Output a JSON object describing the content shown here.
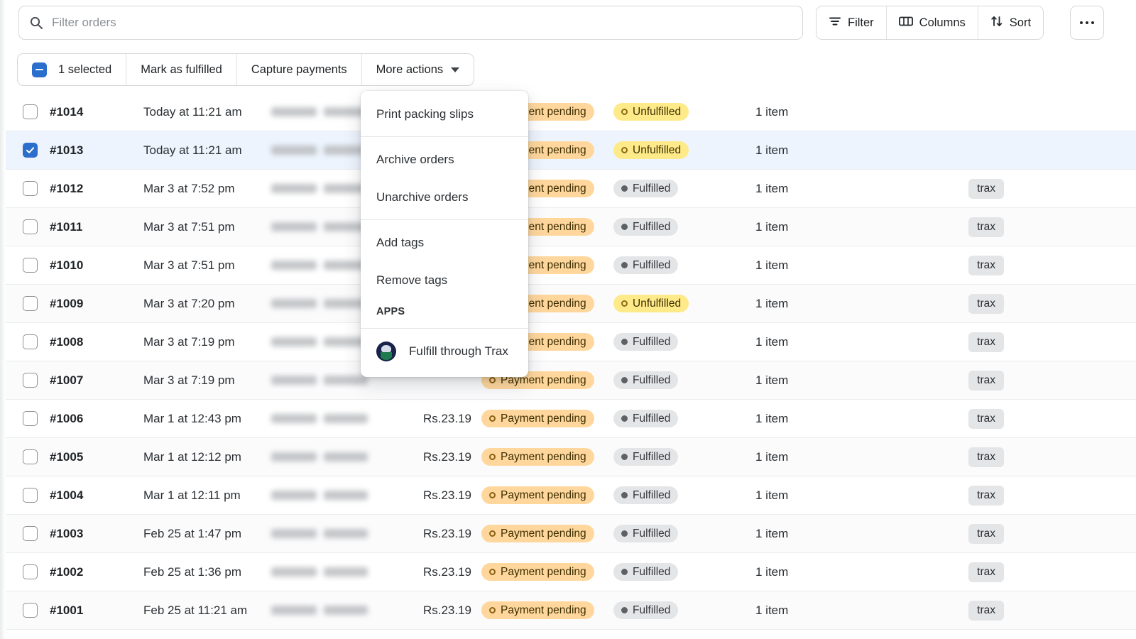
{
  "search": {
    "placeholder": "Filter orders",
    "value": "",
    "icon": "search-icon"
  },
  "toolbar": {
    "filter_label": "Filter",
    "columns_label": "Columns",
    "sort_label": "Sort",
    "more_label": "•••"
  },
  "bulk_bar": {
    "selected_label": "1 selected",
    "mark_fulfilled_label": "Mark as fulfilled",
    "capture_payments_label": "Capture payments",
    "more_actions_label": "More actions"
  },
  "menu": {
    "groups": [
      {
        "items": [
          {
            "label": "Print packing slips"
          }
        ]
      },
      {
        "items": [
          {
            "label": "Archive orders"
          },
          {
            "label": "Unarchive orders"
          }
        ]
      },
      {
        "items": [
          {
            "label": "Add tags"
          },
          {
            "label": "Remove tags"
          }
        ]
      }
    ],
    "section_label": "APPS",
    "app_item": {
      "label": "Fulfill through Trax",
      "icon": "trax-app-icon"
    }
  },
  "colors": {
    "accent": "#2c6ecb",
    "selected_row": "#edf4fd",
    "payment_pending_bg": "#ffd79d",
    "unfulfilled_bg": "#ffea8a",
    "fulfilled_bg": "#e4e5e7",
    "tag_bg": "#e4e5e7"
  },
  "table": {
    "rows": [
      {
        "order": "#1014",
        "date": "Today at 11:21 am",
        "customer": "",
        "total": "",
        "payment": "Payment pending",
        "fulfillment": "Unfulfilled",
        "items": "1 item",
        "tag": "",
        "selected": false
      },
      {
        "order": "#1013",
        "date": "Today at 11:21 am",
        "customer": "",
        "total": "",
        "payment": "Payment pending",
        "fulfillment": "Unfulfilled",
        "items": "1 item",
        "tag": "",
        "selected": true
      },
      {
        "order": "#1012",
        "date": "Mar 3 at 7:52 pm",
        "customer": "",
        "total": "",
        "payment": "Payment pending",
        "fulfillment": "Fulfilled",
        "items": "1 item",
        "tag": "trax",
        "selected": false
      },
      {
        "order": "#1011",
        "date": "Mar 3 at 7:51 pm",
        "customer": "",
        "total": "",
        "payment": "Payment pending",
        "fulfillment": "Fulfilled",
        "items": "1 item",
        "tag": "trax",
        "selected": false
      },
      {
        "order": "#1010",
        "date": "Mar 3 at 7:51 pm",
        "customer": "",
        "total": "",
        "payment": "Payment pending",
        "fulfillment": "Fulfilled",
        "items": "1 item",
        "tag": "trax",
        "selected": false
      },
      {
        "order": "#1009",
        "date": "Mar 3 at 7:20 pm",
        "customer": "",
        "total": "",
        "payment": "Payment pending",
        "fulfillment": "Unfulfilled",
        "items": "1 item",
        "tag": "trax",
        "selected": false
      },
      {
        "order": "#1008",
        "date": "Mar 3 at 7:19 pm",
        "customer": "",
        "total": "",
        "payment": "Payment pending",
        "fulfillment": "Fulfilled",
        "items": "1 item",
        "tag": "trax",
        "selected": false
      },
      {
        "order": "#1007",
        "date": "Mar 3 at 7:19 pm",
        "customer": "",
        "total": "",
        "payment": "Payment pending",
        "fulfillment": "Fulfilled",
        "items": "1 item",
        "tag": "trax",
        "selected": false
      },
      {
        "order": "#1006",
        "date": "Mar 1 at 12:43 pm",
        "customer": "",
        "total": "Rs.23.19",
        "payment": "Payment pending",
        "fulfillment": "Fulfilled",
        "items": "1 item",
        "tag": "trax",
        "selected": false
      },
      {
        "order": "#1005",
        "date": "Mar 1 at 12:12 pm",
        "customer": "",
        "total": "Rs.23.19",
        "payment": "Payment pending",
        "fulfillment": "Fulfilled",
        "items": "1 item",
        "tag": "trax",
        "selected": false
      },
      {
        "order": "#1004",
        "date": "Mar 1 at 12:11 pm",
        "customer": "",
        "total": "Rs.23.19",
        "payment": "Payment pending",
        "fulfillment": "Fulfilled",
        "items": "1 item",
        "tag": "trax",
        "selected": false
      },
      {
        "order": "#1003",
        "date": "Feb 25 at 1:47 pm",
        "customer": "",
        "total": "Rs.23.19",
        "payment": "Payment pending",
        "fulfillment": "Fulfilled",
        "items": "1 item",
        "tag": "trax",
        "selected": false
      },
      {
        "order": "#1002",
        "date": "Feb 25 at 1:36 pm",
        "customer": "",
        "total": "Rs.23.19",
        "payment": "Payment pending",
        "fulfillment": "Fulfilled",
        "items": "1 item",
        "tag": "trax",
        "selected": false
      },
      {
        "order": "#1001",
        "date": "Feb 25 at 11:21 am",
        "customer": "",
        "total": "Rs.23.19",
        "payment": "Payment pending",
        "fulfillment": "Fulfilled",
        "items": "1 item",
        "tag": "trax",
        "selected": false
      }
    ]
  }
}
